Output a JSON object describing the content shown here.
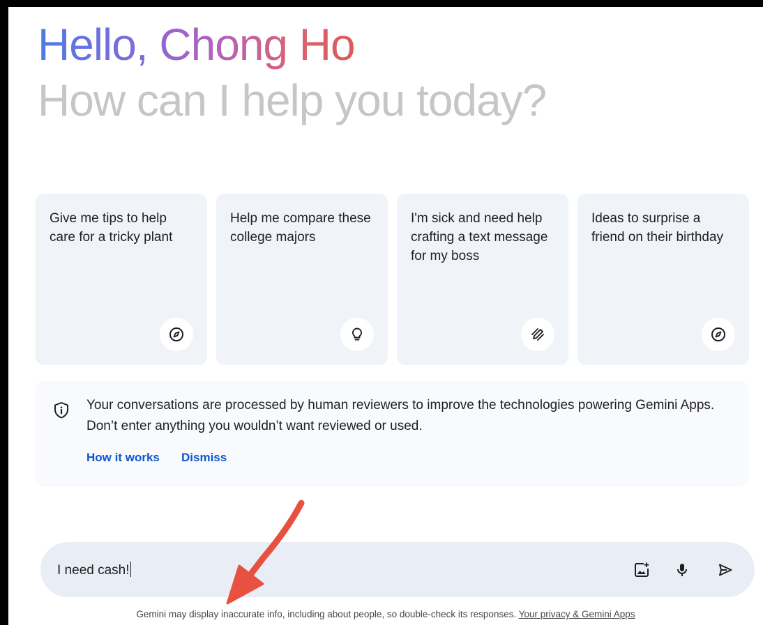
{
  "greeting": {
    "hello": "Hello, Chong Ho",
    "subtitle": "How can I help you today?"
  },
  "cards": [
    {
      "text": "Give me tips to help care for a tricky plant",
      "icon": "compass-icon"
    },
    {
      "text": "Help me compare these college majors",
      "icon": "lightbulb-icon"
    },
    {
      "text": "I'm sick and need help crafting a text message for my boss",
      "icon": "edit-pen-icon"
    },
    {
      "text": "Ideas to surprise a friend on their birthday",
      "icon": "compass-icon"
    }
  ],
  "notice": {
    "text": "Your conversations are processed by human reviewers to improve the technologies powering Gemini Apps. Don’t enter anything you wouldn’t want reviewed or used.",
    "how_it_works": "How it works",
    "dismiss": "Dismiss",
    "icon": "shield-info-icon"
  },
  "input": {
    "value": "I need cash!",
    "icons": [
      "image-upload-icon",
      "microphone-icon",
      "send-icon"
    ]
  },
  "footer": {
    "text": "Gemini may display inaccurate info, including about people, so double-check its responses.",
    "link": "Your privacy & Gemini Apps"
  },
  "colors": {
    "arrow": "#e8503f",
    "link": "#0b57d0",
    "card_bg": "#f0f4f9",
    "input_bg": "#e9eef6"
  }
}
